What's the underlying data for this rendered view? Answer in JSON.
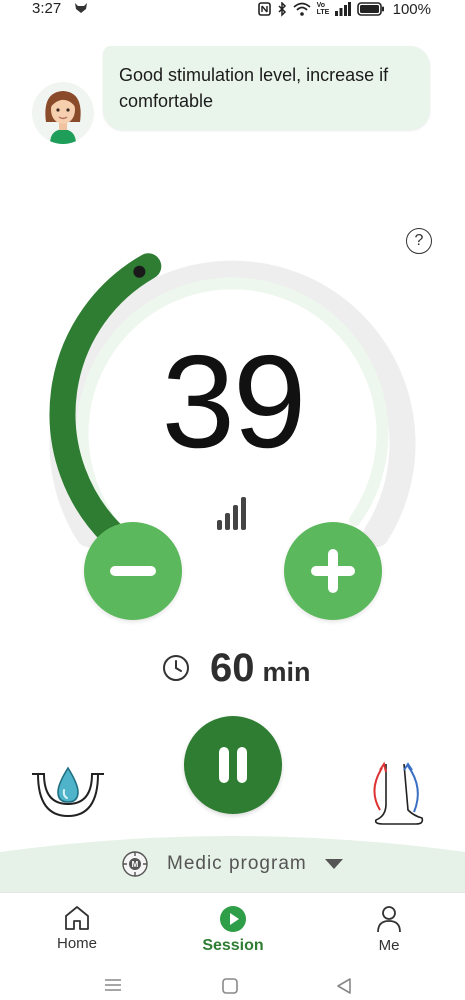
{
  "status_bar": {
    "time": "3:27",
    "battery_pct": "100%",
    "network_label": "Vo LTE"
  },
  "coach": {
    "message": "Good stimulation level, increase if comfortable"
  },
  "help": {
    "label": "?"
  },
  "stimulation": {
    "level": "39",
    "level_fraction": 0.39,
    "accent_color": "#2e7d32",
    "button_color": "#5cb85c"
  },
  "timer": {
    "value": "60",
    "unit": "min"
  },
  "controls": {
    "minus_icon": "minus-icon",
    "plus_icon": "plus-icon",
    "pause_icon": "pause-icon",
    "left_icon": "water-drop-icon",
    "right_icon": "leg-circulation-icon"
  },
  "program": {
    "label": "Medic program",
    "icon_letter": "M"
  },
  "bottom_nav": {
    "items": [
      {
        "label": "Home",
        "icon": "home-icon",
        "active": false
      },
      {
        "label": "Session",
        "icon": "play-circle-icon",
        "active": true
      },
      {
        "label": "Me",
        "icon": "person-icon",
        "active": false
      }
    ]
  }
}
